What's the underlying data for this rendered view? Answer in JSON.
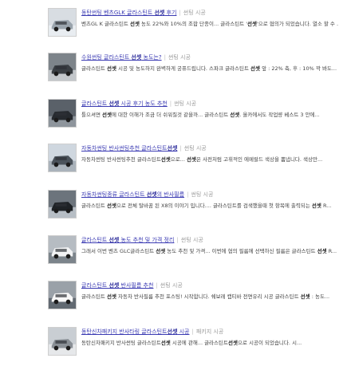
{
  "results": [
    {
      "title": "동탄썬팅 벤츠GLK 글라스틴트 선셋 후기",
      "source": "썬팅 시공",
      "snippet": "벤츠GL K 글라스틴트 선셋 농도 22%와 10%의 조합 단종이... 글라스틴트 '선셋'으로 협의가 되었습니다. 열소 할 수 ...",
      "thumb": "suv-silver"
    },
    {
      "title": "수원썬팅 글라스틴트 선셋 농도는?",
      "source": "썬팅 시공",
      "snippet": "글라스틴트 선셋 시공 및 농도하지 완벽하게 궁퓨드립니다. 스파크 글라스틴트 선셋 앞 : 22% 축, 후 : 10% 깍 봐도...",
      "thumb": "car-lot"
    },
    {
      "title": "글라스틴트 선셋 시공 후기 농도 추천",
      "source": "썬팅 시공",
      "snippet": "틀으셔면 선셋에 대한 이해가 조금 더 쉬워질것 같을까... 글라스틴트 선셋. 올카에서도 작업량 베스트 3 안에...",
      "thumb": "sedan-dark"
    },
    {
      "title": "자동차썬팅 반사썬팅추천 글라스틴트선셋",
      "source": "썬팅 시공",
      "snippet": "자동차썬팅 반사썬팅추천 글라스틴트선셋으로... 선셋은 사전처럼 고휘적인 에메랄드 색상을 뽐냅니다. 색상만...",
      "thumb": "suv-building"
    },
    {
      "title": "자동차썬팅종류 글라스틴트 선셋의 반사필름",
      "source": "썬팅 시공",
      "snippet": "글라스틴트 선셋으로 전체 탈바꿈 된 X8의 이야기 입니다.... 글라스틴트를 검색했을때 첫 항목에 출력되는 선셋 R...",
      "thumb": "suv-black"
    },
    {
      "title": "글라스틴트 선셋 농도 추천 및 가격 정리",
      "source": "썬팅 시공",
      "snippet": "그래서 이번 벤츠 GLC글라스틴트 선셋 농도 추천 및 가격... 이번에 협의 필름에 선택하신 필름은 글라스틴트 선셋 R...",
      "thumb": "suv-white"
    },
    {
      "title": "글라스틴트 선셋 반사필름 추천",
      "source": "썬팅 시공",
      "snippet": "글라스틴트 선셋 자동차 반사필름 추천 포스팅! 시작합니다. 쉐보레 캡티바 전면유리 시공 글라스틴트 선셋 : 농도...",
      "thumb": "suv-white2"
    },
    {
      "title": "동탄신차패키지 반사타링 글라스틴트선셋 시공",
      "source": "패키지 시공",
      "snippet": "동탄신차패키지 반사썬팅 글라스틴트선셋 시공에 관해... 글라스틴트선셋으로 시공이 되었습니다. 시...",
      "thumb": "suv-grey"
    }
  ]
}
